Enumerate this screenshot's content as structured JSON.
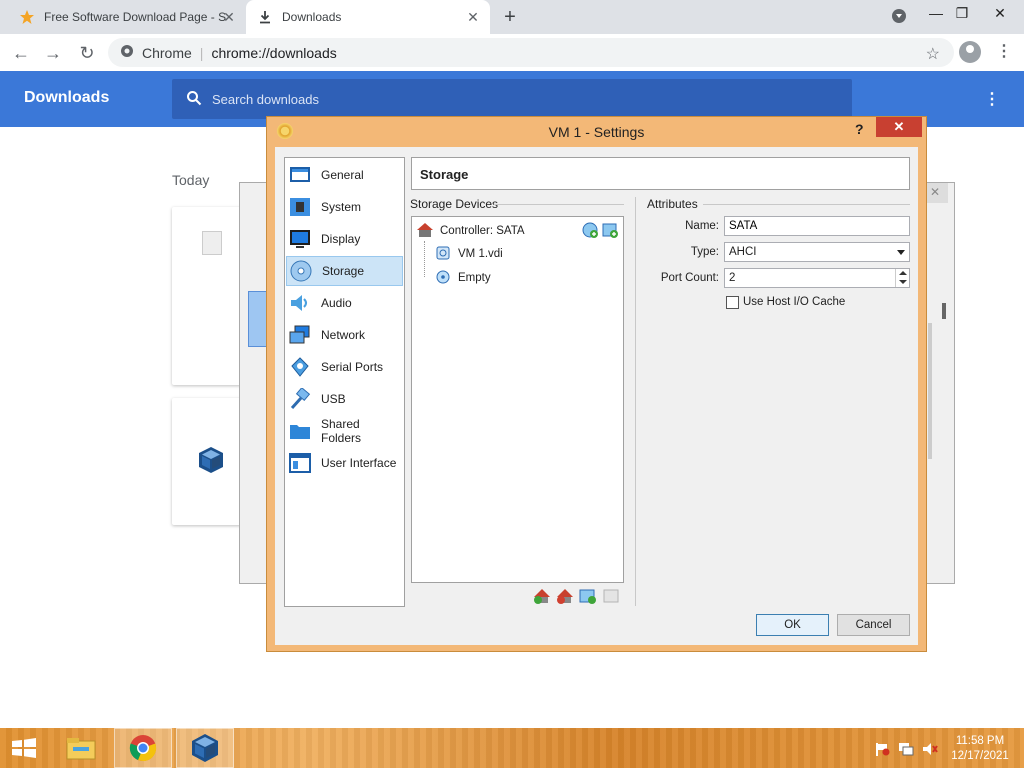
{
  "browser": {
    "tabs": [
      {
        "title": "Free Software Download Page - S",
        "icon": "star-icon"
      },
      {
        "title": "Downloads",
        "icon": "download-icon"
      }
    ],
    "omnibox": {
      "site_chip": "Chrome",
      "url": "chrome://downloads"
    }
  },
  "downloads_page": {
    "title": "Downloads",
    "search_placeholder": "Search downloads",
    "section_today": "Today"
  },
  "dialog": {
    "title": "VM 1 - Settings",
    "help": "?",
    "close": "✕",
    "nav": [
      {
        "label": "General",
        "icon": "general-icon"
      },
      {
        "label": "System",
        "icon": "system-chip-icon"
      },
      {
        "label": "Display",
        "icon": "display-monitor-icon"
      },
      {
        "label": "Storage",
        "icon": "storage-disk-icon",
        "selected": true
      },
      {
        "label": "Audio",
        "icon": "audio-speaker-icon"
      },
      {
        "label": "Network",
        "icon": "network-icon"
      },
      {
        "label": "Serial Ports",
        "icon": "serial-port-icon"
      },
      {
        "label": "USB",
        "icon": "usb-icon"
      },
      {
        "label": "Shared Folders",
        "icon": "folder-icon"
      },
      {
        "label": "User Interface",
        "icon": "user-interface-icon"
      }
    ],
    "section_title": "Storage",
    "storage_devices_label": "Storage Devices",
    "attributes_label": "Attributes",
    "tree": {
      "controller": "Controller: SATA",
      "items": [
        {
          "label": "VM 1.vdi",
          "icon": "hard-disk-icon"
        },
        {
          "label": "Empty",
          "icon": "optical-disk-icon"
        }
      ]
    },
    "attributes": {
      "name_label": "Name:",
      "name_value": "SATA",
      "type_label": "Type:",
      "type_value": "AHCI",
      "port_count_label": "Port Count:",
      "port_count_value": "2",
      "host_io_cache_label": "Use Host I/O Cache",
      "host_io_cache_checked": false
    },
    "buttons": {
      "ok": "OK",
      "cancel": "Cancel"
    }
  },
  "taskbar": {
    "time": "11:58 PM",
    "date": "12/17/2021"
  },
  "colors": {
    "chrome_blue": "#3b78d8",
    "dialog_frame": "#f3b877",
    "taskbar": "#e1902f",
    "selected_nav": "#cce4f7"
  }
}
